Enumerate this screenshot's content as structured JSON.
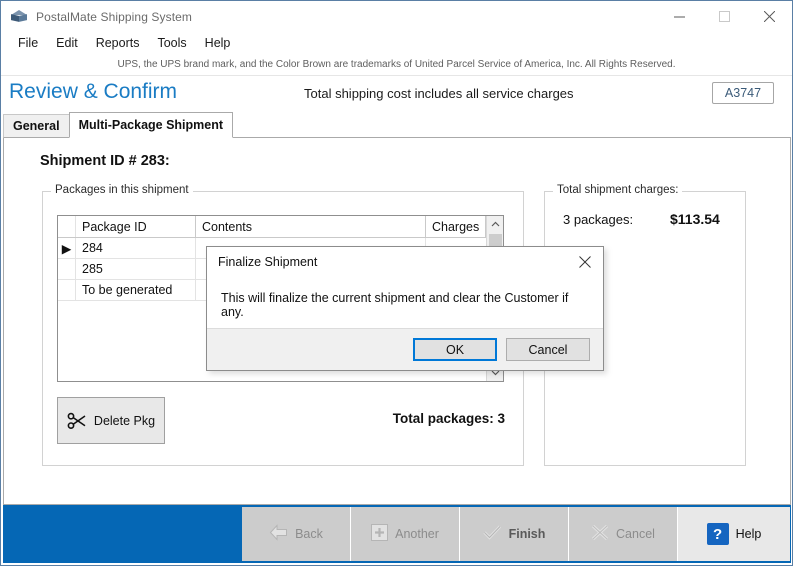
{
  "window": {
    "title": "PostalMate Shipping System",
    "icon": "cube-icon",
    "controls": [
      {
        "name": "minimize-button",
        "glyph": "minimize-icon"
      },
      {
        "name": "maximize-button",
        "glyph": "maximize-icon"
      },
      {
        "name": "close-button",
        "glyph": "close-icon"
      }
    ]
  },
  "menu": {
    "items": [
      {
        "label": "File"
      },
      {
        "label": "Edit"
      },
      {
        "label": "Reports"
      },
      {
        "label": "Tools"
      },
      {
        "label": "Help"
      }
    ]
  },
  "trademark": "UPS, the UPS brand mark, and the Color Brown are trademarks of United Parcel Service of America, Inc. All Rights Reserved.",
  "header": {
    "title": "Review & Confirm",
    "subtitle": "Total shipping cost includes all service charges",
    "badge": "A3747",
    "title_color": "#1a7cc4"
  },
  "tabs": [
    {
      "label": "General",
      "active": false
    },
    {
      "label": "Multi-Package Shipment",
      "active": true
    }
  ],
  "main": {
    "shipment_id_label": "Shipment ID # 283:",
    "packages_group_label": "Packages in this shipment",
    "charges_group_label": "Total shipment charges:",
    "charges_count_label": "3 packages:",
    "charges_amount": "$113.54",
    "delete_button_label": "Delete Pkg",
    "delete_button_icon": "scissors-icon",
    "total_packages_label": "Total packages: 3",
    "grid": {
      "columns": [
        "Package ID",
        "Contents",
        "Charges"
      ],
      "rows": [
        {
          "selected": true,
          "package_id": "284",
          "contents": "",
          "charges": ""
        },
        {
          "selected": false,
          "package_id": "285",
          "contents": "",
          "charges": ""
        },
        {
          "selected": false,
          "package_id": "To be generated",
          "contents": "",
          "charges": ""
        }
      ],
      "selection_marker": "▶",
      "scrollbar": {
        "up_arrow": "⌃",
        "down_arrow": "⌄"
      }
    }
  },
  "footer": {
    "bar_color": "#0567b5",
    "buttons": [
      {
        "label": "Back",
        "icon": "back-arrow-icon",
        "enabled": false
      },
      {
        "label": "Another",
        "icon": "plus-box-icon",
        "enabled": false
      },
      {
        "label": "Finish",
        "icon": "check-icon",
        "enabled": false
      },
      {
        "label": "Cancel",
        "icon": "x-icon",
        "enabled": false
      },
      {
        "label": "Help",
        "icon": "question-icon",
        "enabled": true
      }
    ]
  },
  "dialog": {
    "title": "Finalize Shipment",
    "message": "This will finalize the current shipment and clear the Customer if any.",
    "ok_label": "OK",
    "cancel_label": "Cancel",
    "close_icon": "close-icon",
    "accent_color": "#0078d7"
  }
}
